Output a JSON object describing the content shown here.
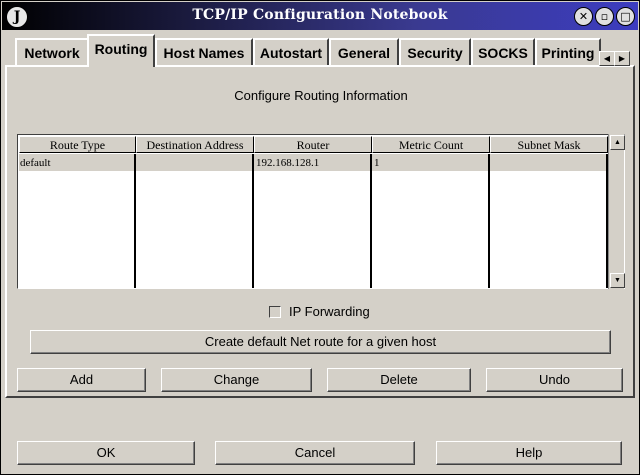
{
  "window": {
    "title": "TCP/IP Configuration Notebook",
    "app_icon": "J",
    "controls": [
      "close-icon",
      "minimize-icon",
      "maximize-icon"
    ]
  },
  "tabs": [
    {
      "label": "Network",
      "active": false
    },
    {
      "label": "Routing",
      "active": true
    },
    {
      "label": "Host Names",
      "active": false
    },
    {
      "label": "Autostart",
      "active": false
    },
    {
      "label": "General",
      "active": false
    },
    {
      "label": "Security",
      "active": false
    },
    {
      "label": "SOCKS",
      "active": false
    },
    {
      "label": "Printing",
      "active": false
    }
  ],
  "routing": {
    "heading": "Configure Routing Information",
    "columns": [
      "Route Type",
      "Destination Address",
      "Router",
      "Metric Count",
      "Subnet Mask"
    ],
    "rows": [
      [
        "default",
        "",
        "192.168.128.1",
        "1",
        ""
      ]
    ],
    "ip_forwarding_label": "IP Forwarding",
    "ip_forwarding_checked": false,
    "create_default_label": "Create default Net route for a given host",
    "add_label": "Add",
    "change_label": "Change",
    "delete_label": "Delete",
    "undo_label": "Undo"
  },
  "footer": {
    "ok_label": "OK",
    "cancel_label": "Cancel",
    "help_label": "Help"
  }
}
